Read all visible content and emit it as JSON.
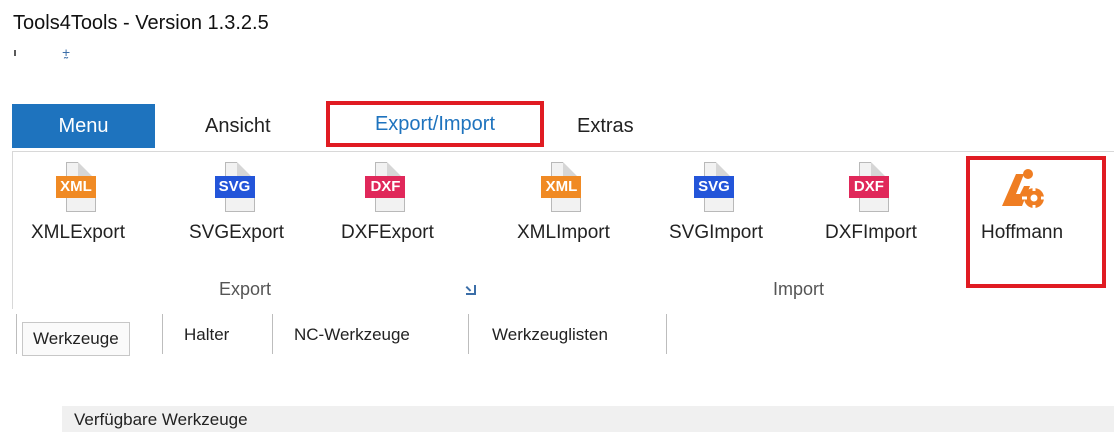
{
  "window": {
    "title": "Tools4Tools - Version 1.3.2.5"
  },
  "qat": {
    "dropdown_glyph": "⨦"
  },
  "tabs": [
    {
      "label": "Menu",
      "active": false
    },
    {
      "label": "Ansicht",
      "active": false
    },
    {
      "label": "Export/Import",
      "active": true
    },
    {
      "label": "Extras",
      "active": false
    }
  ],
  "ribbon": {
    "groups": [
      {
        "label": "Export",
        "buttons": [
          {
            "label": "XMLExport",
            "icon": "xml-file-icon",
            "tag": "XML"
          },
          {
            "label": "SVGExport",
            "icon": "svg-file-icon",
            "tag": "SVG"
          },
          {
            "label": "DXFExport",
            "icon": "dxf-file-icon",
            "tag": "DXF"
          }
        ]
      },
      {
        "label": "Import",
        "buttons": [
          {
            "label": "XMLImport",
            "icon": "xml-file-icon",
            "tag": "XML"
          },
          {
            "label": "SVGImport",
            "icon": "svg-file-icon",
            "tag": "SVG"
          },
          {
            "label": "DXFImport",
            "icon": "dxf-file-icon",
            "tag": "DXF"
          }
        ]
      }
    ],
    "hoffmann": {
      "label": "Hoffmann",
      "icon": "hoffmann-logo-icon"
    }
  },
  "subtabs": [
    {
      "label": "Werkzeuge",
      "active": true
    },
    {
      "label": "Halter",
      "active": false
    },
    {
      "label": "NC-Werkzeuge",
      "active": false
    },
    {
      "label": "Werkzeuglisten",
      "active": false
    }
  ],
  "panel": {
    "header": "Verfügbare Werkzeuge"
  },
  "colors": {
    "accent": "#1e73be",
    "highlight": "#e01b22",
    "xml": "#f08a24",
    "svg": "#2355d9",
    "dxf": "#e0285a",
    "hoffmann": "#ef7d22"
  }
}
